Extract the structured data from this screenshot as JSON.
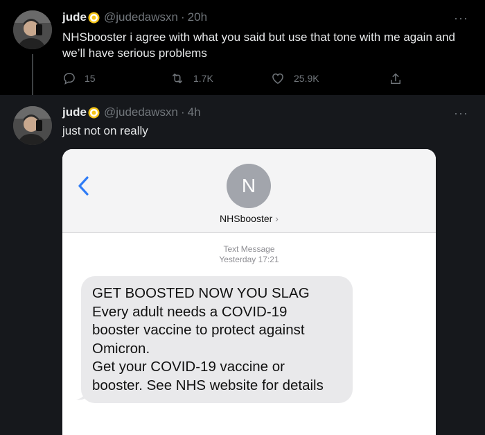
{
  "tweets": [
    {
      "name": "jude",
      "handle": "@judedawsxn",
      "separator": "·",
      "time": "20h",
      "text_lines": [
        "NHSbooster i agree with what you said but use that tone with me again and",
        "we’ll have serious problems"
      ],
      "stats": {
        "replies": "15",
        "retweets": "1.7K",
        "likes": "25.9K"
      }
    },
    {
      "name": "jude",
      "handle": "@judedawsxn",
      "separator": "·",
      "time": "4h",
      "text_lines": [
        "just not on really"
      ]
    }
  ],
  "more_label": "···",
  "sms": {
    "contact_initial": "N",
    "contact_name": "NHSbooster",
    "contact_chevron": "›",
    "message_type": "Text Message",
    "message_time": "Yesterday 17:21",
    "bubble_lines": [
      "GET BOOSTED NOW YOU SLAG",
      "Every adult needs a COVID-19",
      "booster vaccine to protect against",
      "Omicron.",
      "Get your COVID-19 vaccine or",
      "booster. See NHS website for details"
    ]
  },
  "colors": {
    "background": "#000000",
    "secondary_text": "#71767b",
    "ios_blue": "#2f7cf6",
    "bubble_gray": "#e9e9eb",
    "badge_yellow": "#f5c518"
  },
  "icons": [
    "reply-icon",
    "retweet-icon",
    "like-icon",
    "share-icon",
    "more-icon",
    "back-chevron-icon",
    "badge-icon"
  ]
}
